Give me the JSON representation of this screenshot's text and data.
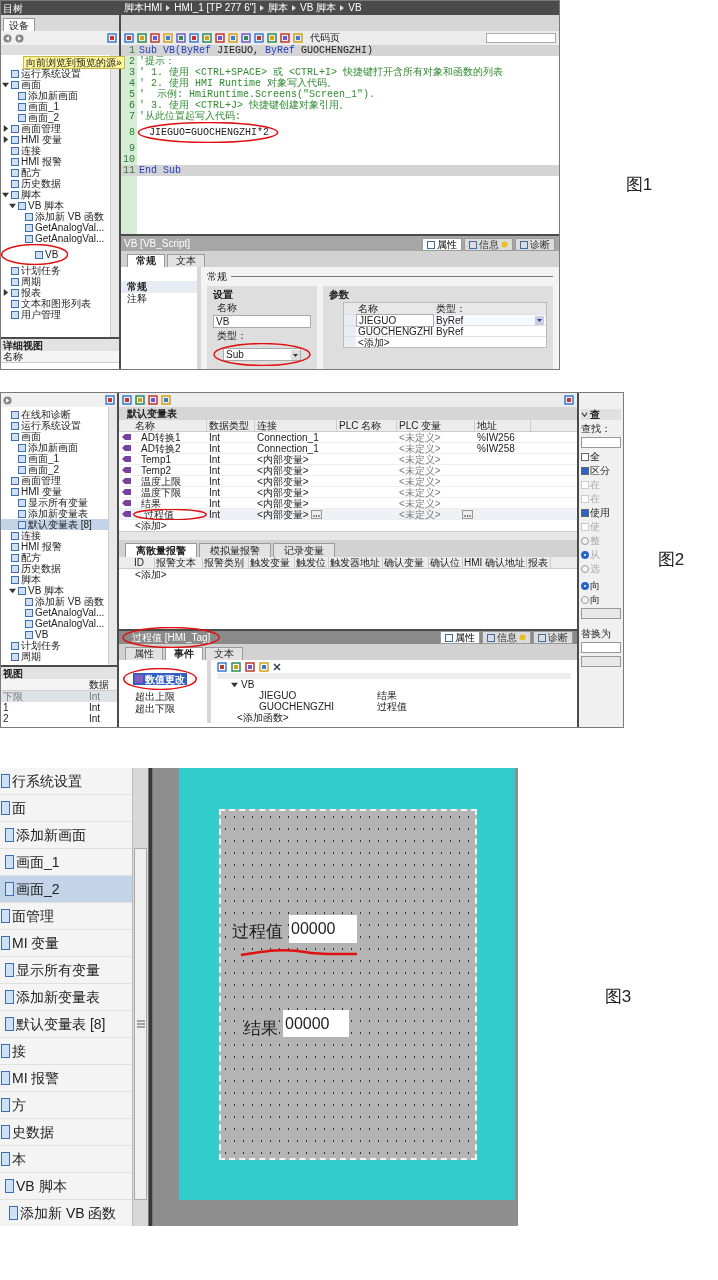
{
  "fig1": {
    "caption": "图1",
    "project_tree": {
      "title": "目树",
      "tab": "设备",
      "tooltip": "向前浏览到预览的源»",
      "items": [
        {
          "label": "运行系统设置"
        },
        {
          "label": "画面",
          "expanded": true,
          "children": [
            {
              "label": "添加新画面"
            },
            {
              "label": "画面_1"
            },
            {
              "label": "画面_2"
            }
          ]
        },
        {
          "label": "画面管理",
          "expanded": false
        },
        {
          "label": "HMI 变量",
          "expanded": false
        },
        {
          "label": "连接"
        },
        {
          "label": "HMI 报警"
        },
        {
          "label": "配方"
        },
        {
          "label": "历史数据"
        },
        {
          "label": "脚本",
          "expanded": true,
          "children": [
            {
              "label": "VB 脚本",
              "expanded": true,
              "children": [
                {
                  "label": "添加新 VB 函数"
                },
                {
                  "label": "GetAnalogVal..."
                },
                {
                  "label": "GetAnalogVal..."
                },
                {
                  "label": "VB"
                }
              ]
            }
          ]
        },
        {
          "label": "计划任务"
        },
        {
          "label": "周期"
        },
        {
          "label": "报表",
          "expanded": false
        },
        {
          "label": "文本和图形列表"
        },
        {
          "label": "用户管理"
        }
      ]
    },
    "details_view": {
      "title": "详细视图",
      "column": "名称"
    },
    "editor": {
      "breadcrumb": [
        "脚本HMI",
        "HMI_1 [TP 277 6\"]",
        "脚本",
        "VB 脚本",
        "VB"
      ],
      "code_page_label": "代码页",
      "lines": [
        {
          "num": "1",
          "highlighted": true,
          "segments": [
            {
              "text": "Sub VB(ByRef",
              "kind": "keyword"
            },
            {
              "text": " JIEGUO, ",
              "kind": "plain"
            },
            {
              "text": "ByRef",
              "kind": "keyword"
            },
            {
              "text": " GUOCHENGZHI)",
              "kind": "plain"
            }
          ]
        },
        {
          "num": "2",
          "highlighted": false,
          "segments": [
            {
              "text": "'提示：",
              "kind": "comment"
            }
          ]
        },
        {
          "num": "3",
          "highlighted": false,
          "segments": [
            {
              "text": "' 1. 使用 <CTRL+SPACE> 或 <CTRL+I> 快捷键打开含所有对象和函数的列表",
              "kind": "comment"
            }
          ]
        },
        {
          "num": "4",
          "highlighted": false,
          "segments": [
            {
              "text": "' 2. 使用 HMI Runtime 对象写入代码。",
              "kind": "comment"
            }
          ]
        },
        {
          "num": "5",
          "highlighted": false,
          "segments": [
            {
              "text": "'  示例: HmiRuntime.Screens(\"Screen_1\").",
              "kind": "comment"
            }
          ]
        },
        {
          "num": "6",
          "highlighted": false,
          "segments": [
            {
              "text": "' 3. 使用 <CTRL+J> 快捷键创建对象引用。",
              "kind": "comment"
            }
          ]
        },
        {
          "num": "7",
          "highlighted": false,
          "segments": [
            {
              "text": "'从此位置起写入代码:",
              "kind": "comment"
            }
          ]
        },
        {
          "num": "8",
          "highlighted": false,
          "segments": [
            {
              "text": "JIEGUO=GUOCHENGZHI*2",
              "kind": "plain"
            }
          ]
        },
        {
          "num": "9",
          "highlighted": false
        },
        {
          "num": "10",
          "highlighted": false
        },
        {
          "num": "11",
          "highlighted": true,
          "segments": [
            {
              "text": "End Sub",
              "kind": "keyword"
            }
          ]
        }
      ]
    },
    "properties": {
      "title": "VB [VB_Script]",
      "inspector_tabs": [
        {
          "label": "属性",
          "selected": true
        },
        {
          "label": "信息",
          "selected": false
        },
        {
          "label": "诊断",
          "selected": false
        }
      ],
      "tabs": [
        {
          "label": "常规",
          "selected": true
        },
        {
          "label": "文本",
          "selected": false
        }
      ],
      "nav": [
        {
          "label": "常规",
          "selected": true
        },
        {
          "label": "注释",
          "selected": false
        }
      ],
      "section": "常规",
      "settings": {
        "title": "设置",
        "name_label": "名称",
        "name_value": "VB",
        "type_label": "类型：",
        "type_value": "Sub"
      },
      "params": {
        "title": "参数",
        "columns": [
          "名称",
          "类型："
        ],
        "rows": [
          {
            "name": "JIEGUO",
            "type": "ByRef",
            "selected": true
          },
          {
            "name": "GUOCHENGZHI",
            "type": "ByRef",
            "selected": false
          },
          {
            "name": "<添加>",
            "selected": false
          }
        ]
      }
    }
  },
  "fig2": {
    "caption": "图2",
    "project_tree": {
      "items": [
        {
          "label": "在线和诊断"
        },
        {
          "label": "运行系统设置"
        },
        {
          "label": "画面",
          "children": [
            {
              "label": "添加新画面"
            },
            {
              "label": "画面_1"
            },
            {
              "label": "画面_2"
            }
          ]
        },
        {
          "label": "画面管理"
        },
        {
          "label": "HMI 变量",
          "children": [
            {
              "label": "显示所有变量",
              "selected": false
            },
            {
              "label": "添加新变量表",
              "selected": false
            },
            {
              "label": "默认变量表 [8]",
              "selected": true
            }
          ]
        },
        {
          "label": "连接"
        },
        {
          "label": "HMI 报警"
        },
        {
          "label": "配方"
        },
        {
          "label": "历史数据"
        },
        {
          "label": "脚本",
          "children": [
            {
              "label": "VB 脚本",
              "expanded": true,
              "children": [
                {
                  "label": "添加新 VB 函数"
                },
                {
                  "label": "GetAnalogVal..."
                },
                {
                  "label": "GetAnalogVal..."
                },
                {
                  "label": "VB"
                }
              ]
            }
          ]
        },
        {
          "label": "计划任务"
        },
        {
          "label": "周期"
        }
      ]
    },
    "details_view": {
      "title": "视图",
      "column": "数据",
      "rows": [
        {
          "name": "下限",
          "type": "Int",
          "selected": true
        },
        {
          "name": "1",
          "type": "Int",
          "selected": false
        },
        {
          "name": "2",
          "type": "Int",
          "selected": false
        }
      ]
    },
    "tag_table": {
      "title": "默认变量表",
      "columns": [
        "名称",
        "数据类型",
        "连接",
        "PLC 名称",
        "PLC 变量",
        "地址"
      ],
      "rows": [
        {
          "name": "AD转换1",
          "type": "Int",
          "connection": "Connection_1",
          "plc_tag": "<未定义>",
          "address": "%IW256",
          "selected": false
        },
        {
          "name": "AD转换2",
          "type": "Int",
          "connection": "Connection_1",
          "plc_tag": "<未定义>",
          "address": "%IW258",
          "selected": false
        },
        {
          "name": "Temp1",
          "type": "Int",
          "connection": "<内部变量>",
          "plc_tag": "<未定义>",
          "selected": false
        },
        {
          "name": "Temp2",
          "type": "Int",
          "connection": "<内部变量>",
          "plc_tag": "<未定义>",
          "selected": false
        },
        {
          "name": "温度上限",
          "type": "Int",
          "connection": "<内部变量>",
          "plc_tag": "<未定义>",
          "selected": false
        },
        {
          "name": "温度下限",
          "type": "Int",
          "connection": "<内部变量>",
          "plc_tag": "<未定义>",
          "selected": false
        },
        {
          "name": "结果",
          "type": "Int",
          "connection": "<内部变量>",
          "plc_tag": "<未定义>",
          "selected": false
        },
        {
          "name": "过程值",
          "type": "Int",
          "connection": "<内部变量>",
          "plc_tag": "<未定义>",
          "selected": true
        }
      ],
      "add_row": "<添加>"
    },
    "alarm_tabs": [
      {
        "label": "离散量报警",
        "selected": true
      },
      {
        "label": "模拟量报警",
        "selected": false
      },
      {
        "label": "记录变量",
        "selected": false
      }
    ],
    "alarm_columns": [
      "ID",
      "报警文本",
      "报警类别",
      "触发变量",
      "触发位",
      "触发器地址",
      "确认变量",
      "确认位",
      "HMI 确认地址",
      "报表"
    ],
    "alarm_add": "<添加>",
    "properties": {
      "title": "过程值 [HMI_Tag]",
      "inspector_tabs": [
        {
          "label": "属性",
          "selected": true
        },
        {
          "label": "信息",
          "selected": false
        },
        {
          "label": "诊断",
          "selected": false
        }
      ],
      "tabs": [
        {
          "label": "属性",
          "selected": false
        },
        {
          "label": "事件",
          "selected": true
        },
        {
          "label": "文本",
          "selected": false
        }
      ],
      "events": [
        {
          "label": "数值更改",
          "selected": true
        },
        {
          "label": "超出上限",
          "selected": false
        },
        {
          "label": "超出下限",
          "selected": false
        }
      ],
      "function": {
        "name": "VB",
        "expanded": true,
        "params": [
          {
            "name": "JIEGUO",
            "value": "结果"
          },
          {
            "name": "GUOCHENGZHI",
            "value": "过程值"
          }
        ],
        "add": "<添加函数>"
      }
    },
    "find_panel": {
      "title": "查",
      "find_label": "查找：",
      "checkboxes": [
        {
          "label": "全",
          "checked": false,
          "disabled": false
        },
        {
          "label": "区分",
          "checked": true,
          "disabled": false
        },
        {
          "label": "在",
          "checked": false,
          "disabled": true
        },
        {
          "label": "在",
          "checked": false,
          "disabled": true
        },
        {
          "label": "使用",
          "checked": true,
          "disabled": false
        },
        {
          "label": "使",
          "checked": false,
          "disabled": true
        }
      ],
      "scope_radios": [
        {
          "label": "整",
          "selected": false
        },
        {
          "label": "从",
          "selected": true
        },
        {
          "label": "选",
          "selected": false
        }
      ],
      "direction_radios": [
        {
          "label": "向",
          "selected": true
        },
        {
          "label": "向",
          "selected": false
        }
      ],
      "replace_label": "替换为"
    }
  },
  "fig3": {
    "caption": "图3",
    "project_tree": {
      "items": [
        {
          "label": "行系统设置"
        },
        {
          "label": "面",
          "children": [
            {
              "label": "添加新画面"
            },
            {
              "label": "画面_1",
              "selected": false
            },
            {
              "label": "画面_2",
              "selected": true
            }
          ]
        },
        {
          "label": "面管理"
        },
        {
          "label": "MI 变量",
          "children": [
            {
              "label": "显示所有变量"
            },
            {
              "label": "添加新变量表"
            },
            {
              "label": "默认变量表 [8]"
            }
          ]
        },
        {
          "label": "接"
        },
        {
          "label": "MI 报警"
        },
        {
          "label": "方"
        },
        {
          "label": "史数据"
        },
        {
          "label": "本",
          "children": [
            {
              "label": "VB 脚本",
              "children": [
                {
                  "label": "添加新 VB 函数"
                }
              ]
            }
          ]
        }
      ]
    },
    "screen": {
      "fields": [
        {
          "label": "过程值",
          "value": "00000"
        },
        {
          "label": "结果",
          "value": "00000"
        }
      ]
    }
  }
}
